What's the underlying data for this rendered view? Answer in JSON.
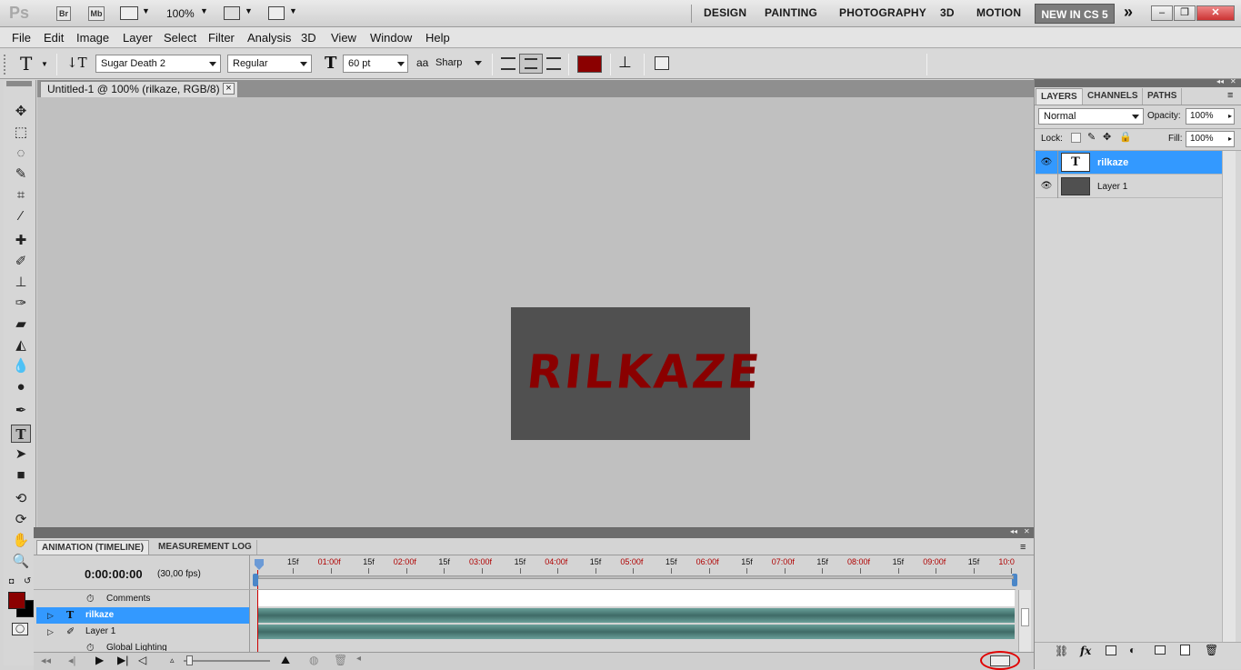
{
  "app": {
    "logo": "Ps",
    "bridge_label": "Br",
    "minibridge_label": "Mb",
    "zoom": "100%",
    "workspaces": [
      "DESIGN",
      "PAINTING",
      "PHOTOGRAPHY",
      "3D",
      "MOTION"
    ],
    "workspace_active": "NEW IN CS 5",
    "more_glyph": "»"
  },
  "menu": [
    "File",
    "Edit",
    "Image",
    "Layer",
    "Select",
    "Filter",
    "Analysis",
    "3D",
    "View",
    "Window",
    "Help"
  ],
  "options": {
    "tool_glyph": "T",
    "font_family": "Sugar Death 2",
    "font_style": "Regular",
    "font_size": "60 pt",
    "antialias_label": "aa",
    "antialias": "Sharp",
    "text_color": "#8b0000"
  },
  "document": {
    "tab_title": "Untitled-1 @ 100% (rilkaze, RGB/8) *",
    "close_glyph": "×",
    "canvas_text": "RILKAZE",
    "canvas_bg": "#505050",
    "text_color": "#8a0000"
  },
  "layers_panel": {
    "tabs": [
      "LAYERS",
      "CHANNELS",
      "PATHS"
    ],
    "blend_mode": "Normal",
    "opacity_label": "Opacity:",
    "opacity": "100%",
    "lock_label": "Lock:",
    "fill_label": "Fill:",
    "fill": "100%",
    "layers": [
      {
        "name": "rilkaze",
        "thumb": "T",
        "selected": true
      },
      {
        "name": "Layer 1",
        "thumb": "",
        "selected": false
      }
    ],
    "footer_icons": [
      "link-icon",
      "fx-icon",
      "mask-icon",
      "adjustment-icon",
      "group-icon",
      "new-layer-icon",
      "trash-icon"
    ],
    "fx_label": "fx"
  },
  "timeline": {
    "tabs": [
      "ANIMATION (TIMELINE)",
      "MEASUREMENT LOG"
    ],
    "current_time": "0:00:00:00",
    "fps": "(30,00 fps)",
    "ticks": [
      "15f",
      "01:00f",
      "15f",
      "02:00f",
      "15f",
      "03:00f",
      "15f",
      "04:00f",
      "15f",
      "05:00f",
      "15f",
      "06:00f",
      "15f",
      "07:00f",
      "15f",
      "08:00f",
      "15f",
      "09:00f",
      "15f",
      "10:0"
    ],
    "rows": [
      {
        "name": "Comments",
        "type": "comments"
      },
      {
        "name": "rilkaze",
        "type": "text",
        "selected": true
      },
      {
        "name": "Layer 1",
        "type": "layer"
      },
      {
        "name": "Global Lighting",
        "type": "global"
      }
    ],
    "accent_color": "#3399ff"
  }
}
